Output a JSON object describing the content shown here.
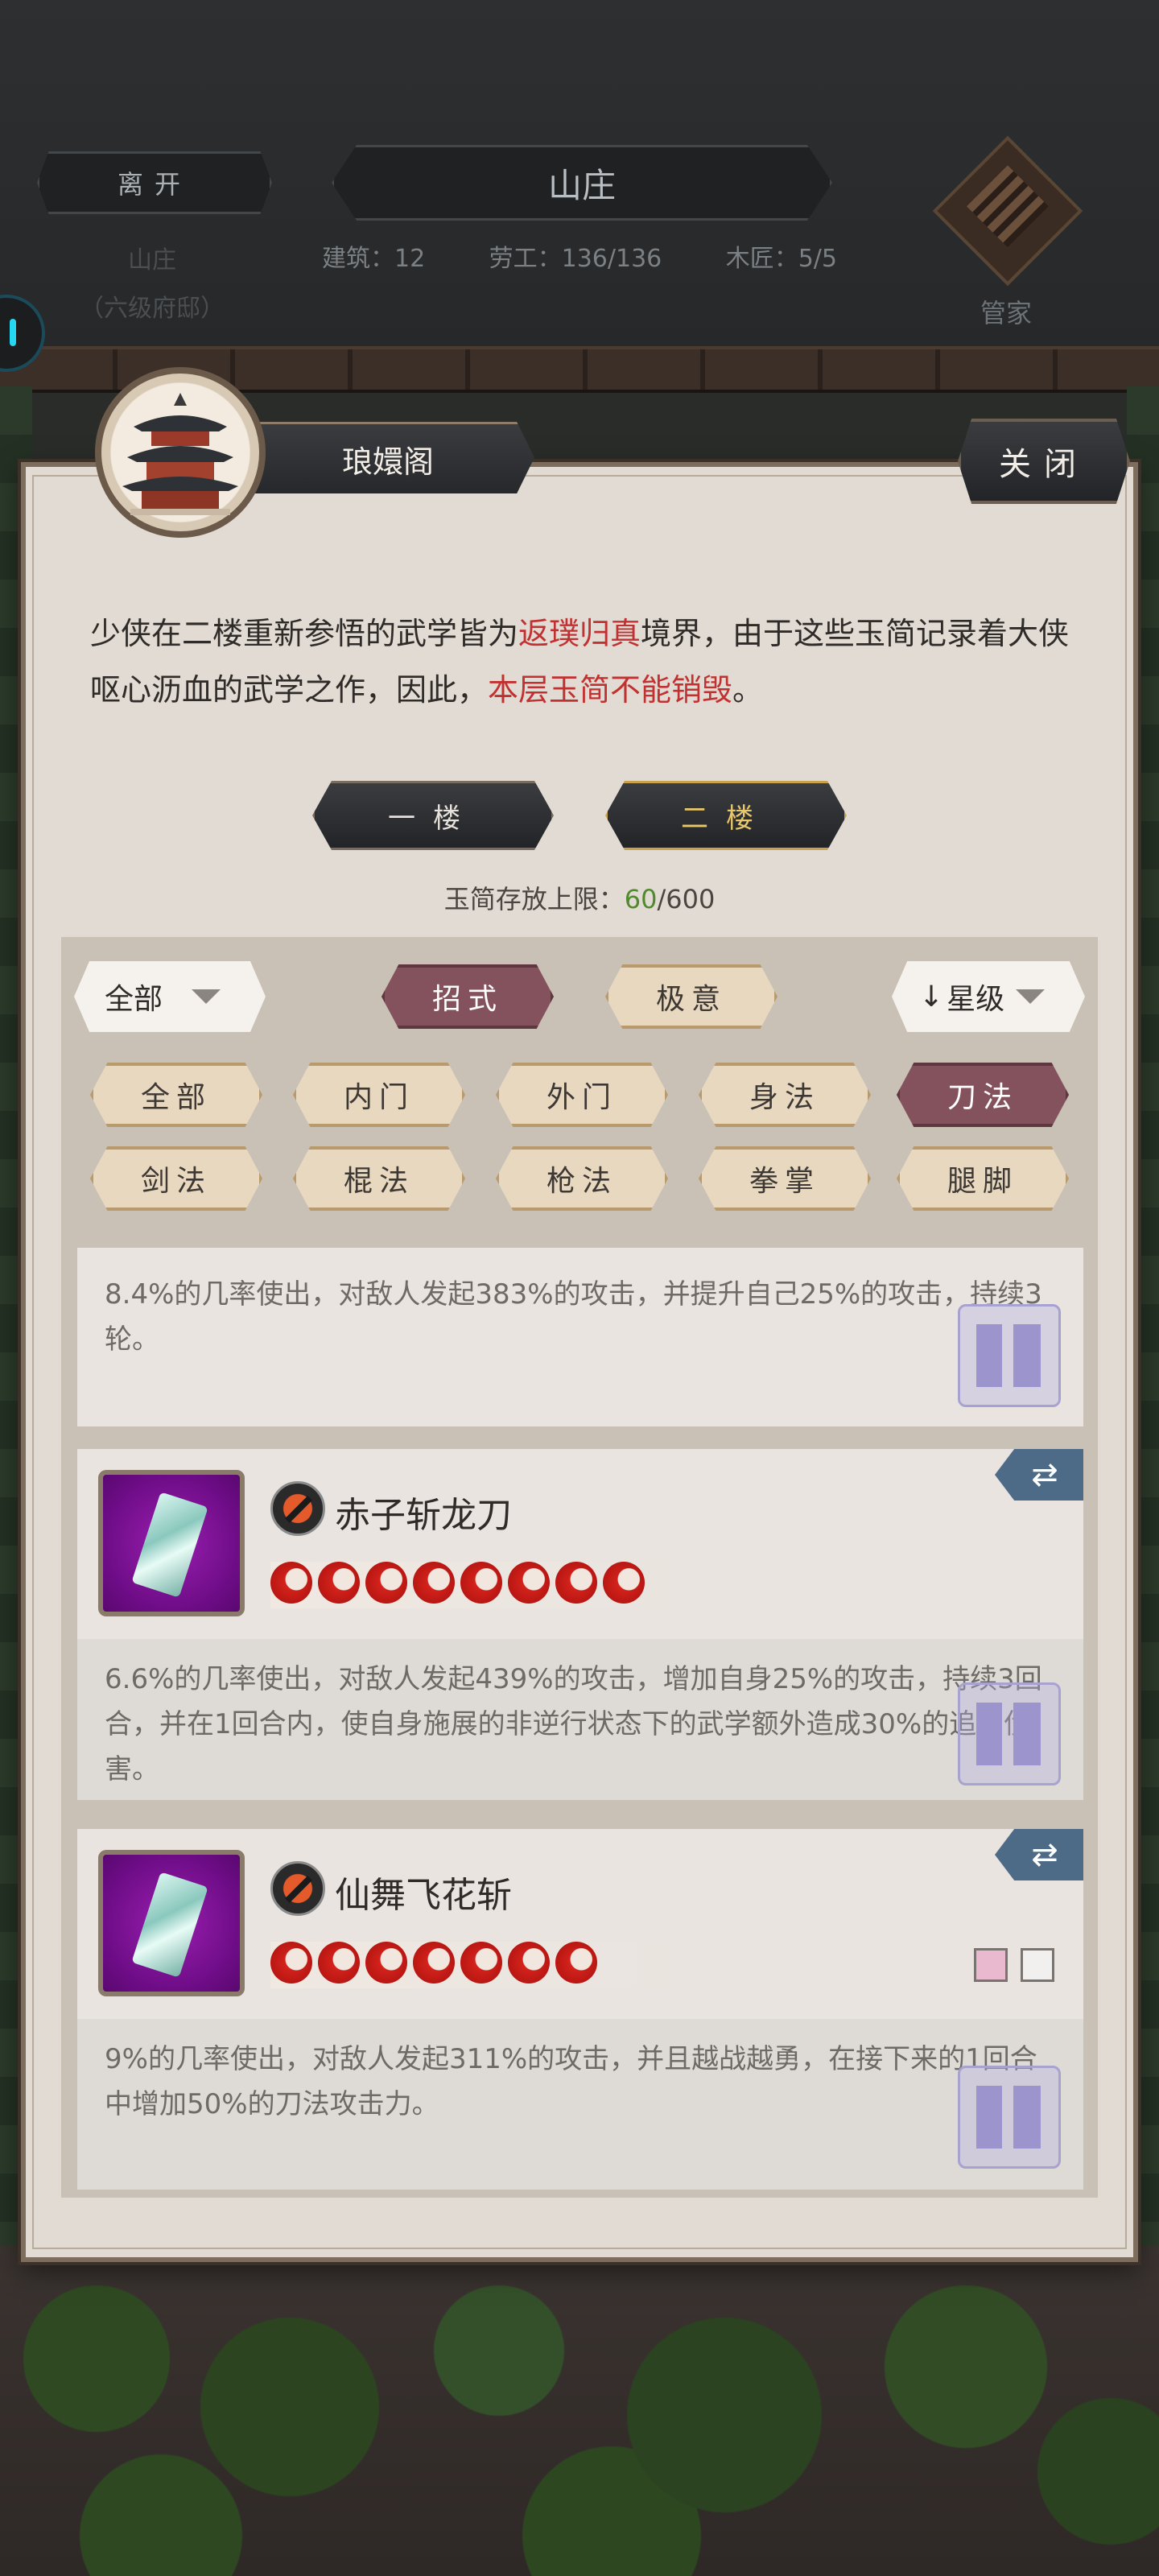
{
  "hud": {
    "leave_label": "离开",
    "title": "山庄",
    "estate_name": "山庄",
    "estate_rank": "（六级府邸）",
    "stats": {
      "buildings": "建筑：12",
      "workers": "劳工：136/136",
      "carpenters": "木匠：5/5"
    },
    "steward_label": "管家",
    "steward_icon": "abacus-icon"
  },
  "dialog": {
    "title": "琅嬛阁",
    "close_label": "关闭",
    "description": {
      "part1": "少侠在二楼重新参悟的武学皆为",
      "highlight1": "返璞归真",
      "part2": "境界，由于这些玉简记录着大侠呕心沥血的武学之作，因此，",
      "highlight2": "本层玉简不能销毁",
      "part3": "。"
    },
    "floors": [
      "一楼",
      "二楼"
    ],
    "active_floor": "二楼",
    "capacity": {
      "label": "玉简存放上限：",
      "current": "60",
      "max": "/600"
    },
    "colors": {
      "highlight_red": "#c23131",
      "active_pill": "#83525c",
      "count_green": "#4f8a2e"
    }
  },
  "filters": {
    "category_dropdown": "全部",
    "types": [
      "招式",
      "极意"
    ],
    "active_type": "招式",
    "sort_dropdown": "星级",
    "sort_arrow": "↓",
    "schools_row1": [
      "全部",
      "内门",
      "外门",
      "身法",
      "刀法"
    ],
    "schools_row2": [
      "剑法",
      "棍法",
      "枪法",
      "拳掌",
      "腿脚"
    ],
    "active_school": "刀法"
  },
  "skills": [
    {
      "name": "",
      "description": "8.4%的几率使出，对敌人发起383%的攻击，并提升自己25%的攻击，持续3轮。",
      "seal_icon": "seal-stamp-icon"
    },
    {
      "name": "赤子斩龙刀",
      "stars": 8,
      "description": "6.6%的几率使出，对敌人发起439%的攻击，增加自身25%的攻击，持续3回合，并在1回合内，使自身施展的非逆行状态下的武学额外造成30%的追加伤害。",
      "swap_icon": "swap-arrows-icon",
      "weapon_icon": "blade-icon"
    },
    {
      "name": "仙舞飞花斩",
      "stars": 7,
      "description": "9%的几率使出，对敌人发起311%的攻击，并且越战越勇，在接下来的1回合中增加50%的刀法攻击力。",
      "swap_icon": "swap-arrows-icon",
      "weapon_icon": "blade-icon",
      "tag_icons": [
        "sword-tag-icon",
        "spear-tag-icon"
      ]
    }
  ]
}
